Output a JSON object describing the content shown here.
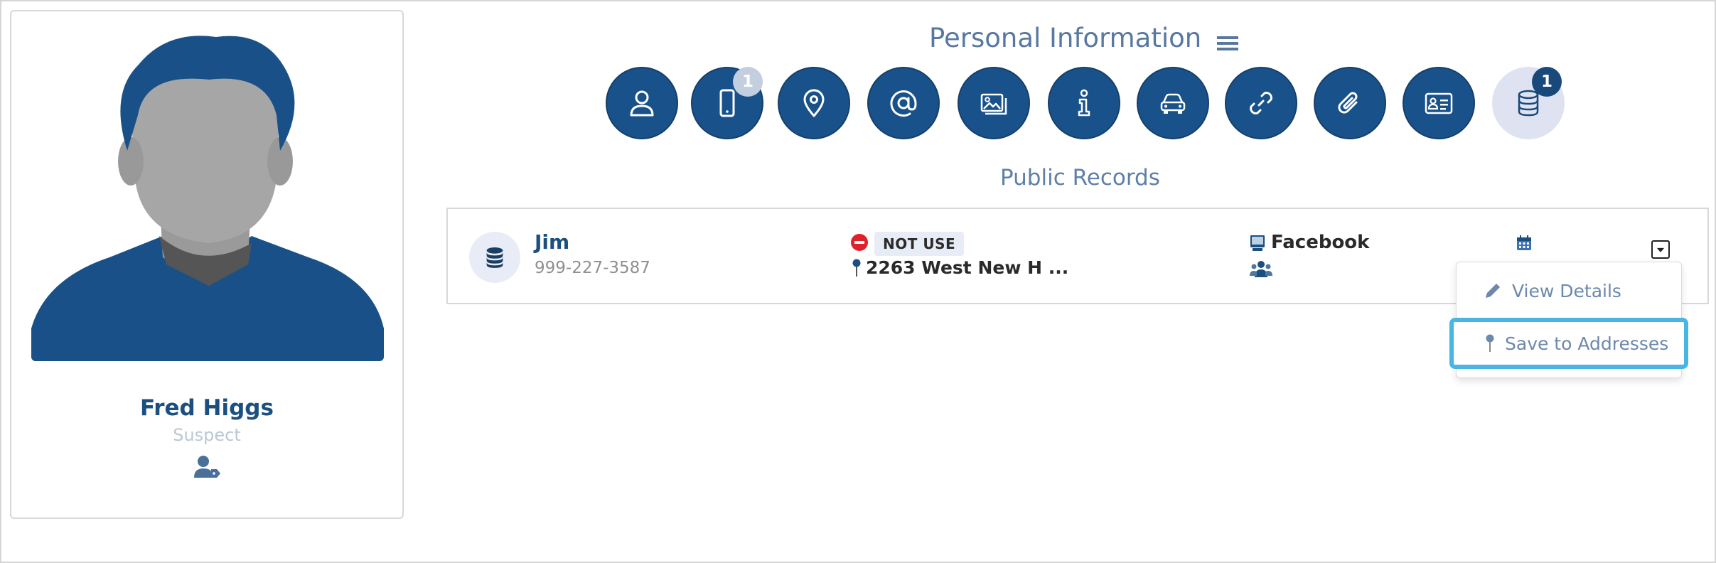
{
  "profile": {
    "name": "Fred Higgs",
    "role": "Suspect",
    "avatar_icon": "person-silhouette-icon",
    "action_icon": "user-tag-icon"
  },
  "header": {
    "title": "Personal Information",
    "menu_icon": "hamburger-menu-icon"
  },
  "categories": [
    {
      "icon": "user-icon",
      "badge": ""
    },
    {
      "icon": "mobile-phone-icon",
      "badge": "1"
    },
    {
      "icon": "map-pin-icon",
      "badge": ""
    },
    {
      "icon": "at-sign-icon",
      "badge": ""
    },
    {
      "icon": "images-icon",
      "badge": ""
    },
    {
      "icon": "info-icon",
      "badge": ""
    },
    {
      "icon": "car-icon",
      "badge": ""
    },
    {
      "icon": "link-icon",
      "badge": ""
    },
    {
      "icon": "paperclip-icon",
      "badge": ""
    },
    {
      "icon": "id-card-icon",
      "badge": ""
    },
    {
      "icon": "database-icon",
      "badge": "1"
    }
  ],
  "section": {
    "title": "Public Records"
  },
  "record": {
    "name": "Jim",
    "phone": "999-227-3587",
    "status": "NOT USE",
    "address": "2263 West New H ...",
    "source": "Facebook"
  },
  "dropdown": {
    "view_label": "View Details",
    "save_label": "Save to Addresses"
  },
  "colors": {
    "primary": "#19528a",
    "active_bg": "#dfe3f1",
    "highlight": "#49b5e3",
    "title_text": "#5878a0"
  }
}
